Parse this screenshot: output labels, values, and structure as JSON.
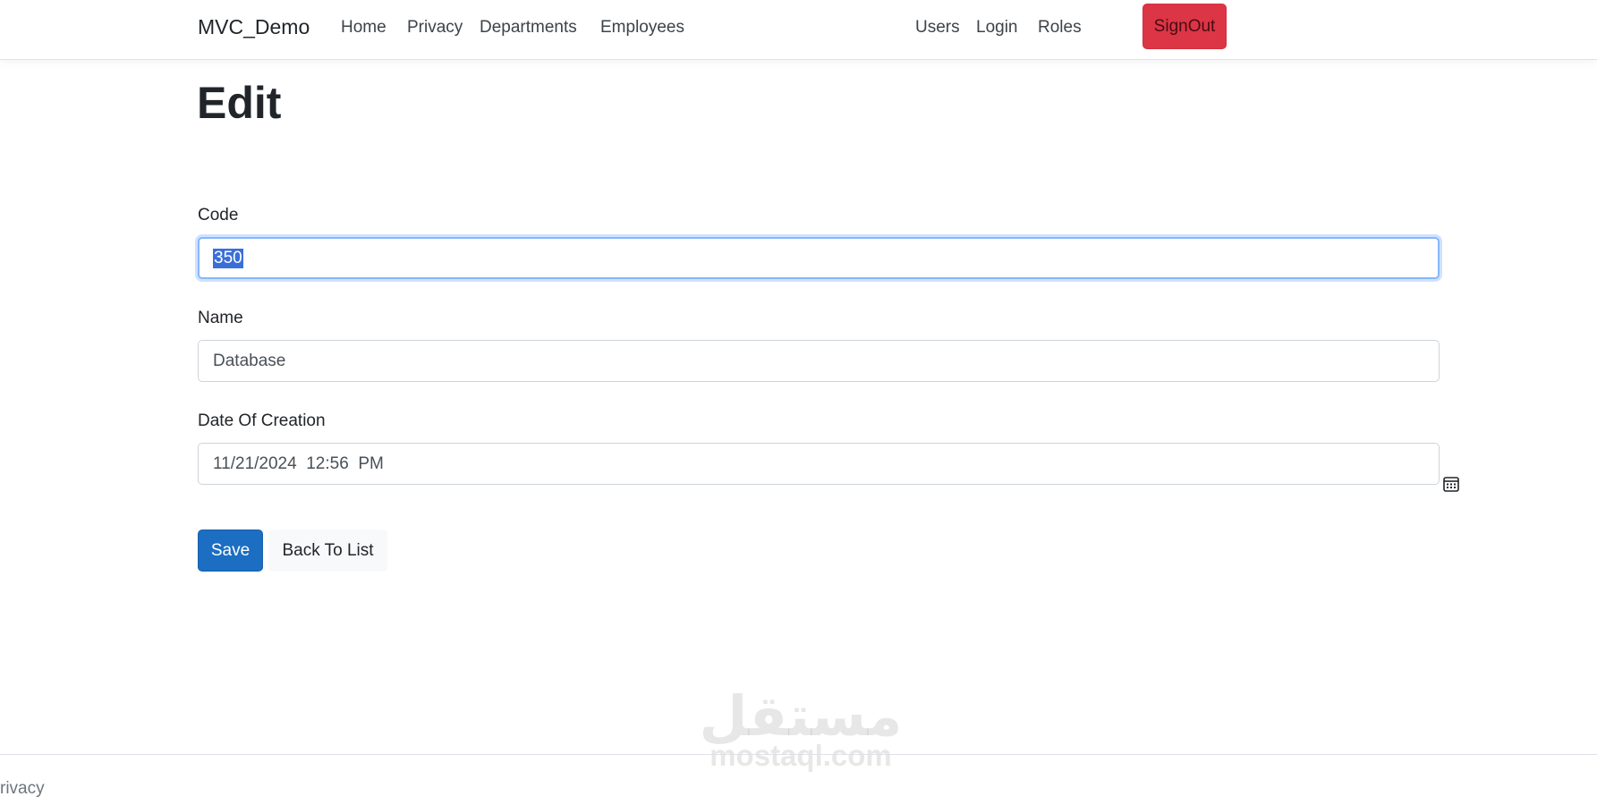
{
  "navbar": {
    "brand": "MVC_Demo",
    "left_links": [
      "Home",
      "Privacy",
      "Departments",
      "Employees"
    ],
    "right_links": [
      "Users",
      "Login",
      "Roles"
    ],
    "signout_label": "SignOut",
    "signout_color": "#dc3545"
  },
  "page": {
    "title": "Edit"
  },
  "form": {
    "code": {
      "label": "Code",
      "value": "350",
      "selected": true,
      "focused": true
    },
    "name": {
      "label": "Name",
      "value": "Database"
    },
    "date_of_creation": {
      "label": "Date Of Creation",
      "value": "11/21/2024  12:56  PM",
      "icon": "calendar-icon"
    },
    "save_label": "Save",
    "save_color": "#1b6ec2",
    "back_label": "Back To List"
  },
  "watermark": {
    "arabic": "مستقل",
    "latin": "mostaql.com"
  },
  "footer": {
    "link": "rivacy"
  }
}
